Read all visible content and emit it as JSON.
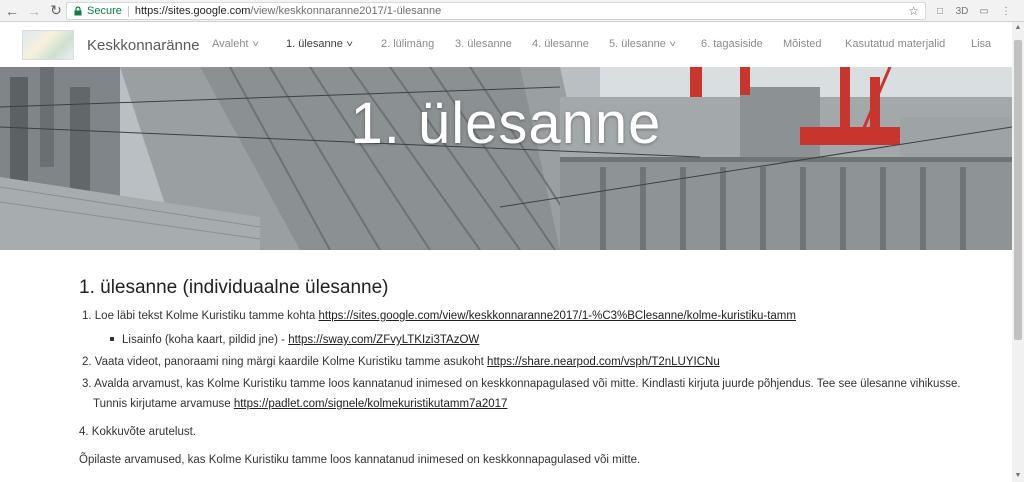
{
  "browser": {
    "secure_label": "Secure",
    "url_host": "https://sites.google.com",
    "url_path": "/view/keskkonnaranne2017/1-ülesanne"
  },
  "site": {
    "name": "Keskkonnaränne",
    "nav": [
      {
        "label": "Avaleht",
        "dropdown": true,
        "active": false
      },
      {
        "label": "1. ülesanne",
        "dropdown": true,
        "active": true
      },
      {
        "label": "2. lülimäng",
        "dropdown": false,
        "active": false
      },
      {
        "label": "3. ülesanne",
        "dropdown": false,
        "active": false
      },
      {
        "label": "4. ülesanne",
        "dropdown": false,
        "active": false
      },
      {
        "label": "5. ülesanne",
        "dropdown": true,
        "active": false
      },
      {
        "label": "6. tagasiside",
        "dropdown": false,
        "active": false
      },
      {
        "label": "Mõisted",
        "dropdown": false,
        "active": false
      },
      {
        "label": "Kasutatud materjalid",
        "dropdown": false,
        "active": false
      },
      {
        "label": "Lisa",
        "dropdown": false,
        "active": false
      }
    ]
  },
  "hero": {
    "title": "1. ülesanne"
  },
  "content": {
    "heading": "1. ülesanne (individuaalne ülesanne)",
    "item1_text": "1. Loe läbi tekst Kolme Kuristiku tamme kohta ",
    "item1_link": "https://sites.google.com/view/keskkonnaranne2017/1-%C3%BClesanne/kolme-kuristiku-tamm",
    "sub1_text": "Lisainfo (koha kaart, pildid jne) - ",
    "sub1_link": "https://sway.com/ZFvyLTKIzi3TAzOW",
    "item2_text": "2. Vaata videot, panoraami ning märgi kaardile Kolme Kuristiku tamme asukoht ",
    "item2_link": "https://share.nearpod.com/vsph/T2nLUYICNu",
    "item3_text": "3. Avalda arvamust, kas Kolme Kuristiku tamme loos kannatanud inimesed on keskkonnapagulased või mitte. Kindlasti kirjuta juurde põhjendus. Tee see ülesanne vihikusse.",
    "item3b_text": "Tunnis kirjutame arvamuse ",
    "item3b_link": "https://padlet.com/signele/kolmekuristikutamm7a2017",
    "item4_text": "4. Kokkuvõte arutelust.",
    "summary_text": "Õpilaste arvamused, kas Kolme Kuristiku tamme loos kannatanud inimesed on keskkonnapagulased või mitte."
  },
  "colors": {
    "secure": "#0b8043",
    "hero_text": "#ffffff"
  }
}
